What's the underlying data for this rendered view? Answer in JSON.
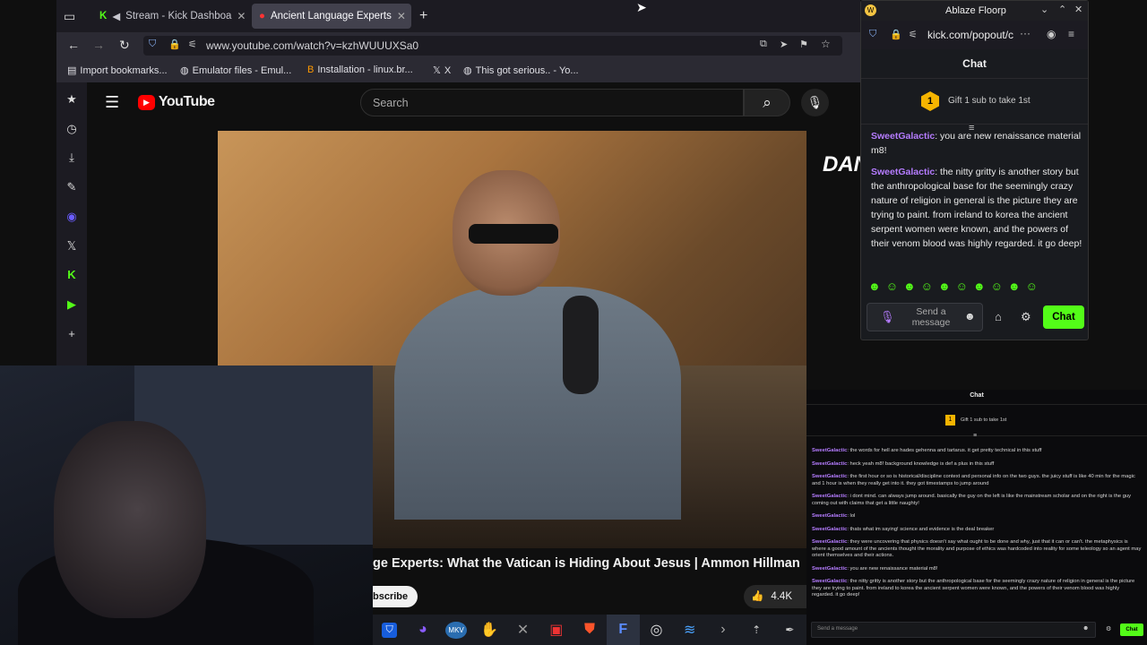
{
  "browser": {
    "tabs": [
      {
        "label": "Stream - Kick Dashboa",
        "icon": "kick-icon",
        "active": false
      },
      {
        "label": "Ancient Language Experts",
        "icon": "youtube-icon",
        "active": true
      }
    ],
    "new_tab": "+",
    "url": "www.youtube.com/watch?v=kzhWUUUXSa0",
    "bookmarks": [
      {
        "label": "Import bookmarks...",
        "icon": "import-icon"
      },
      {
        "label": "Emulator files - Emul...",
        "icon": "globe-icon"
      },
      {
        "label": "Installation - linux.br...",
        "icon": "blogger-icon"
      },
      {
        "label": "X",
        "icon": "x-icon"
      },
      {
        "label": "This got serious.. - Yo...",
        "icon": "globe-icon"
      }
    ]
  },
  "sidebar_icons": [
    "star-icon",
    "history-icon",
    "download-icon",
    "pen-icon",
    "floorp-icon",
    "x-icon",
    "kick-icon",
    "play-icon",
    "add-icon"
  ],
  "youtube": {
    "logo": "YouTube",
    "search_placeholder": "Search",
    "video_title": "ge Experts: What the Vatican is Hiding About Jesus | Ammon Hillman",
    "subscribe": "bscribe",
    "likes": "4.4K",
    "channel_watermark": "DANG"
  },
  "kick_popout": {
    "window_title": "Ablaze Floorp",
    "url": "kick.com/popout/c",
    "heading": "Chat",
    "gift_text": "Gift 1 sub to take 1st",
    "gift_badge": "1",
    "messages": [
      {
        "user": "SweetGalactic",
        "text": ": you are new renaissance material m8!"
      },
      {
        "user": "SweetGalactic",
        "text": ": the nitty gritty is another story but the anthropological base for the seemingly crazy nature of religion in general is the picture they are trying to paint. from ireland to korea the ancient serpent women were known, and the powers of their venom blood was highly regarded. it go deep!"
      }
    ],
    "input_placeholder": "Send a message",
    "chat_button": "Chat",
    "accent": "#53fc18"
  },
  "stream_chat": {
    "heading": "Chat",
    "gift_text": "Gift 1 sub to take 1st",
    "gift_badge": "1",
    "messages": [
      {
        "user": "SweetGalactic",
        "text": ": the words for hell are hades gehenna and tartarus. it get pretty technical in this stuff"
      },
      {
        "user": "SweetGalactic",
        "text": ": heck yeah m8! background knowledge is def a plus in this stuff"
      },
      {
        "user": "SweetGalactic",
        "text": ": the first hour or so is historical/discipline context and personal info on the two guys. the juicy stuff is like 40 min for the magic and 1 hour is when they really get into it. they got timestamps to jump around"
      },
      {
        "user": "SweetGalactic",
        "text": ": i dont mind. can always jump around. basically the guy on the left is like the mainstream scholar and on the right is the guy coming out with claims that get a little naughty!"
      },
      {
        "user": "SweetGalactic",
        "text": ": lol"
      },
      {
        "user": "SweetGalactic",
        "text": ": thats what im saying! science and evidence is the deal breaker"
      },
      {
        "user": "SweetGalactic",
        "text": ": they were uncovering that physics doesn't say what ought to be done and why, just that it can or can't. the metaphysics is where a good amount of the ancients thought the morality and purpose of ethics was hardcoded into reality for some teleology so an agent may orient themselves and their actions."
      },
      {
        "user": "SweetGalactic",
        "text": ": you are new renaissance material m8!"
      },
      {
        "user": "SweetGalactic",
        "text": ": the nitty gritty is another story but the anthropological base for the seemingly crazy nature of religion in general is the picture they are trying to paint. from ireland to korea the ancient serpent women were known, and the powers of their venom blood was highly regarded. it go deep!"
      }
    ],
    "input_placeholder": "Send a message",
    "chat_button": "Chat"
  },
  "taskbar_icons": [
    "bitwarden-icon",
    "browser-icon",
    "mkv-icon",
    "hand-icon",
    "app-icon",
    "red-app-icon",
    "brave-icon",
    "floorp-icon",
    "obs-icon",
    "stack-icon",
    "terminal-icon",
    "tray-icon",
    "pen-tray-icon"
  ]
}
